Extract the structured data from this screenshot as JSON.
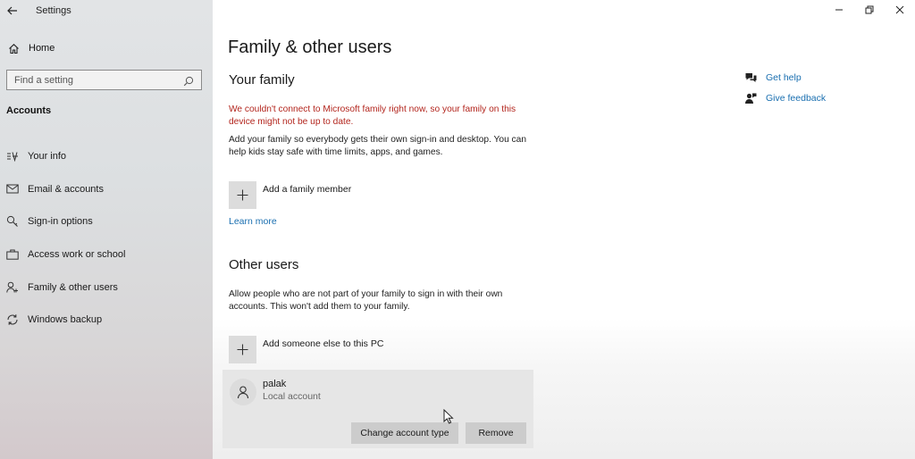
{
  "app": {
    "title": "Settings"
  },
  "sidebar": {
    "home_label": "Home",
    "search_placeholder": "Find a setting",
    "section_header": "Accounts",
    "items": [
      {
        "label": "Your info",
        "icon": "your-info-icon"
      },
      {
        "label": "Email & accounts",
        "icon": "email-icon"
      },
      {
        "label": "Sign-in options",
        "icon": "key-icon"
      },
      {
        "label": "Access work or school",
        "icon": "briefcase-icon"
      },
      {
        "label": "Family & other users",
        "icon": "person-add-icon"
      },
      {
        "label": "Windows backup",
        "icon": "sync-icon"
      }
    ]
  },
  "main": {
    "page_title": "Family & other users",
    "your_family": {
      "heading": "Your family",
      "error": "We couldn't connect to Microsoft family right now, so your family on this device might not be up to date.",
      "description": "Add your family so everybody gets their own sign-in and desktop. You can help kids stay safe with time limits, apps, and games.",
      "add_label": "Add a family member",
      "learn_more": "Learn more"
    },
    "other_users": {
      "heading": "Other users",
      "description": "Allow people who are not part of your family to sign in with their own accounts. This won't add them to your family.",
      "add_label": "Add someone else to this PC",
      "user": {
        "name": "palak",
        "type": "Local account",
        "change_label": "Change account type",
        "remove_label": "Remove"
      }
    },
    "help": {
      "get_help": "Get help",
      "give_feedback": "Give feedback"
    }
  },
  "colors": {
    "error": "#b3261e",
    "link": "#1a6fb0",
    "button_bg": "#cccccc"
  }
}
